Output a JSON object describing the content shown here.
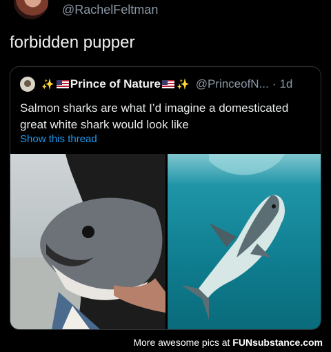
{
  "header": {
    "handle": "@RachelFeltman"
  },
  "tweet": {
    "text": "forbidden pupper"
  },
  "quote": {
    "name": "Prince of Nature",
    "handle": "@PrinceofN...",
    "separator": "·",
    "time": "1d",
    "body": "Salmon sharks are what I’d imagine a domesticated great white shark would look like",
    "show_thread": "Show this thread"
  },
  "footer": {
    "prefix": "More awesome pics at",
    "brand": "FUNsubstance.com"
  },
  "colors": {
    "background": "#000000",
    "link": "#1d9bf0",
    "muted": "#8b98a5",
    "border": "#2f3336"
  },
  "icons": [
    "sparkles-icon",
    "us-flag-icon"
  ]
}
